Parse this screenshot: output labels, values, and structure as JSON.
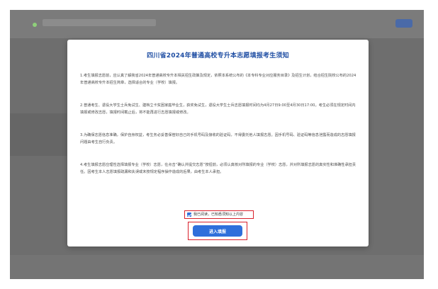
{
  "modal": {
    "title": "四川省2024年普通高校专升本志愿填报考生须知",
    "paragraphs": [
      "1.考生填报志愿前，应认真了解我省2024年普通高校专升本相关招生政策及规定，依照本系统公布的《本专科专业对应服务目录》及招生计划，结合招生院校公布的2024年普通高校专升本招生简章，选择适合的专业（学校）填报。",
      "2.普通考生、退役大学生士兵免试生、建档立卡贫困家庭毕业生，获奖免试生，退役大学生士兵志愿填报时间均为4月27日9:00至4月30日17:00。考生必须在规定时间内填报或修改志愿，填报时间截止后，将不能再进行志愿填报或修改。",
      "3.为确保志愿信息准确，保护自身权益，考生务必妥善保管好自己的手机号码及接收的验证码，不得委托他人填报志愿。因手机号码、验证码等信息泄露而造成的志愿填报问题由考生自行负责。",
      "4.考生填报志愿应理性选择填报专业（学校）志愿，在点击“确认并提交志愿”按钮前，必须认真核对所填报的专业（学校）志愿，并对所填报志愿的真实性和准确性承担责任。因考生本人志愿填报疏漏和失误或未按规定程序操作造成的后果，由考生本人承担。"
    ],
    "agree_label": "我已阅读，已知悉须知以上内容",
    "agree_checked": true,
    "enter_button": "进入填报"
  },
  "colors": {
    "accent": "#2f6fdb",
    "title": "#1f4ea3",
    "highlight": "#d9202b"
  }
}
